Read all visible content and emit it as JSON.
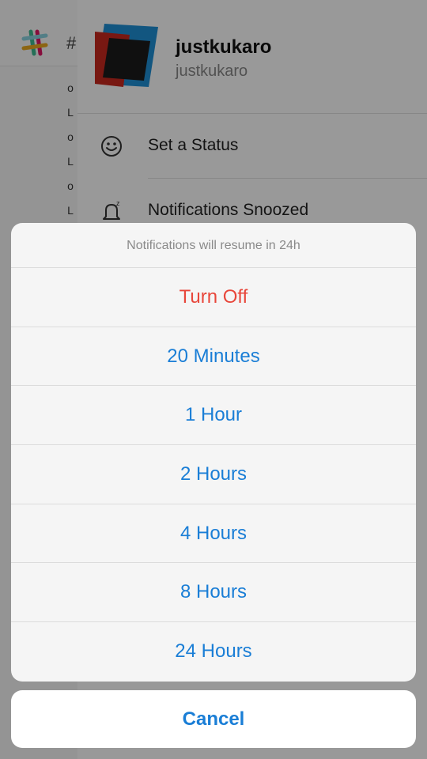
{
  "channel": {
    "hash_prefix": "#",
    "glyphs": [
      "o",
      "L",
      "o",
      "L",
      "o",
      "L"
    ]
  },
  "profile": {
    "display_name": "justkukaro",
    "username": "justkukaro"
  },
  "menu": {
    "set_status": "Set a Status",
    "notifications_snoozed": "Notifications Snoozed"
  },
  "sheet": {
    "title": "Notifications will resume in 24h",
    "options": [
      "Turn Off",
      "20 Minutes",
      "1 Hour",
      "2 Hours",
      "4 Hours",
      "8 Hours",
      "24 Hours"
    ],
    "cancel": "Cancel"
  },
  "colors": {
    "action_blue": "#1a7ed6",
    "destructive_red": "#e8473b"
  }
}
